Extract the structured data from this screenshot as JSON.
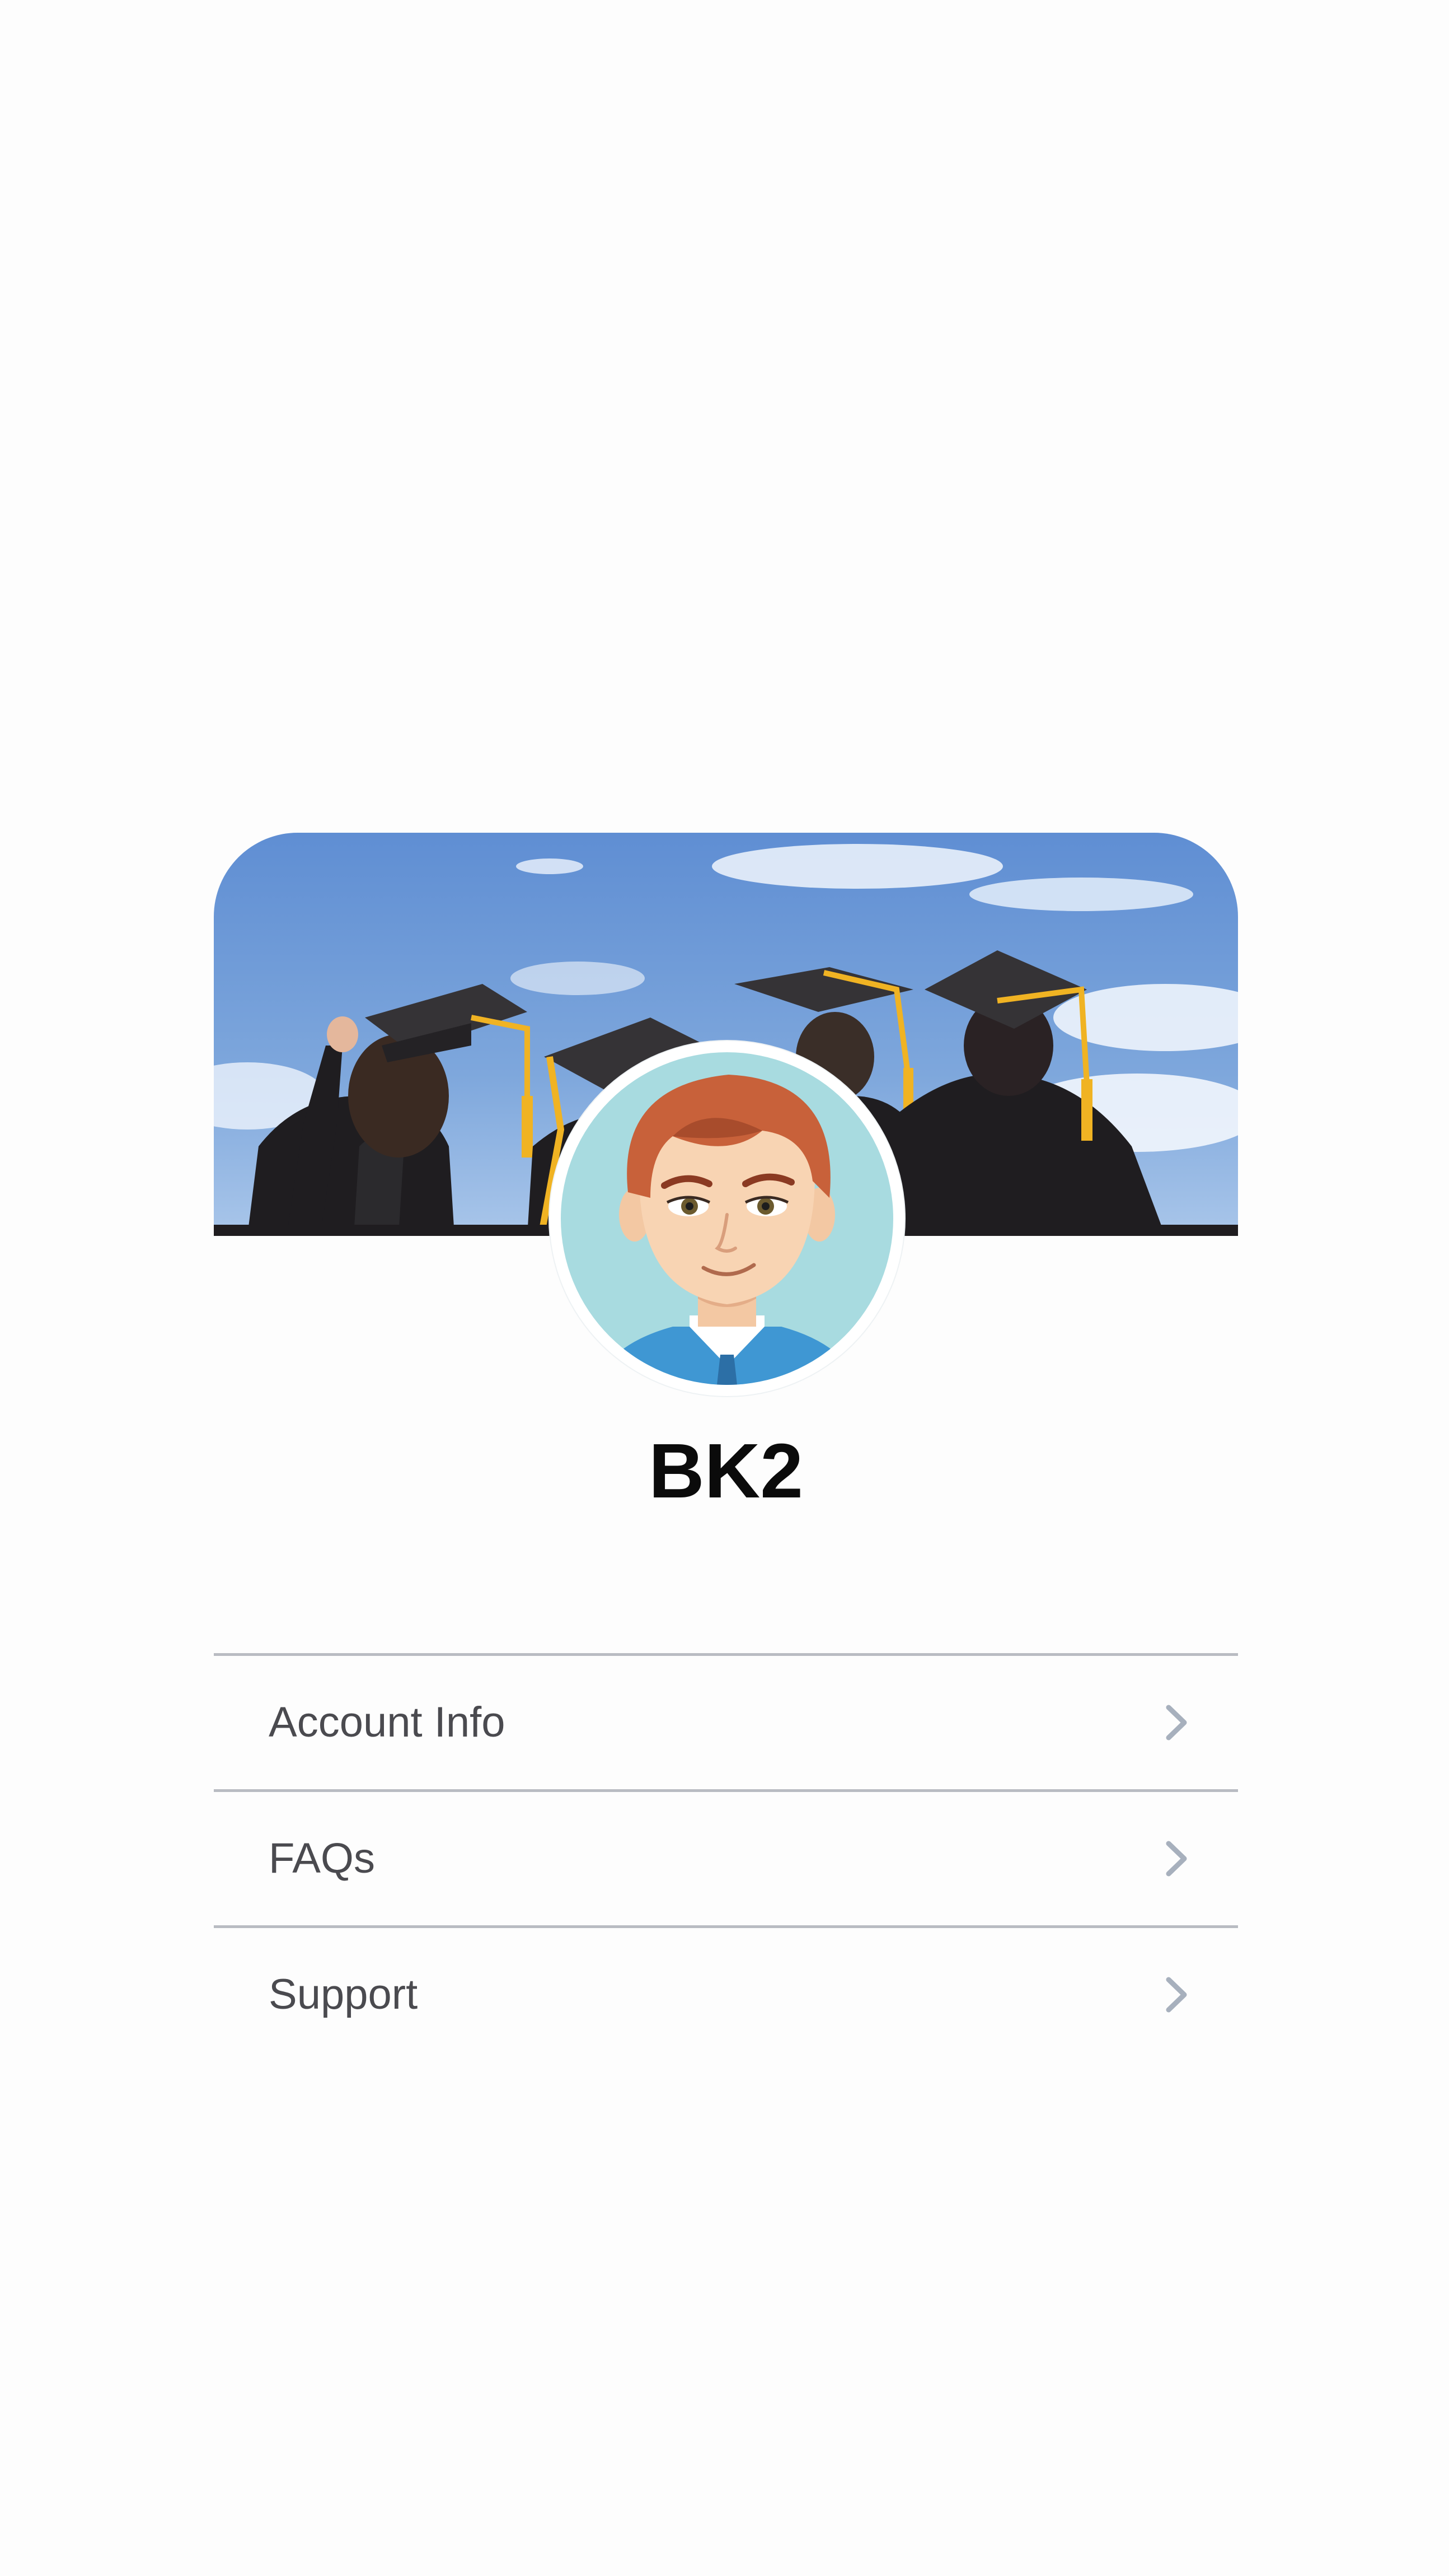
{
  "profile": {
    "username": "BK2",
    "cover_image": "graduates-in-caps-and-gowns-against-sky",
    "avatar_image": "cartoon-man-avatar"
  },
  "menu": {
    "items": [
      {
        "label": "Account Info",
        "icon": "chevron-right-icon"
      },
      {
        "label": "FAQs",
        "icon": "chevron-right-icon"
      },
      {
        "label": "Support",
        "icon": "chevron-right-icon"
      }
    ]
  },
  "colors": {
    "background": "#fdfdfd",
    "divider": "#b9bcc2",
    "label_text": "#4a4a4f",
    "chevron": "#a7b0bd",
    "avatar_bg": "#a8dbe0"
  }
}
